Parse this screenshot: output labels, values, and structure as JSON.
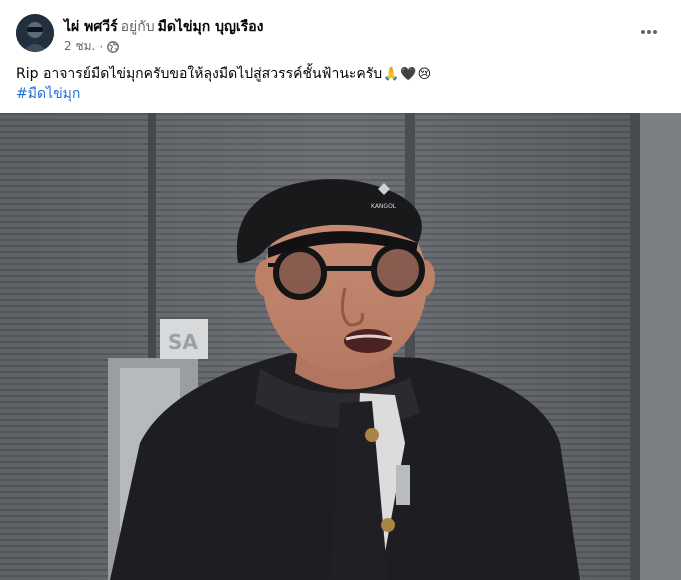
{
  "post": {
    "author_name": "ไผ่ พศวีร์",
    "with_text": "อยู่กับ",
    "tagged_name": "มืดไข่มุก บุญเรือง",
    "timestamp": "2 ชม.",
    "separator": "·",
    "privacy_icon": "globe-icon",
    "more_icon": "ellipsis-icon",
    "caption_text": "Rip อาจารย์มืดไข่มุกครับขอให้ลุงมืดไปสู่สวรรค์ชั้นฟ้านะครับ",
    "caption_emojis": [
      "🙏",
      "🖤",
      "😢"
    ],
    "hashtag": "#มืดไข่มุก",
    "photo_cap_text": "KANGOL",
    "photo_sign_text": "SA"
  },
  "colors": {
    "link": "#216fdb",
    "secondary_text": "#65676b",
    "primary_text": "#050505"
  }
}
